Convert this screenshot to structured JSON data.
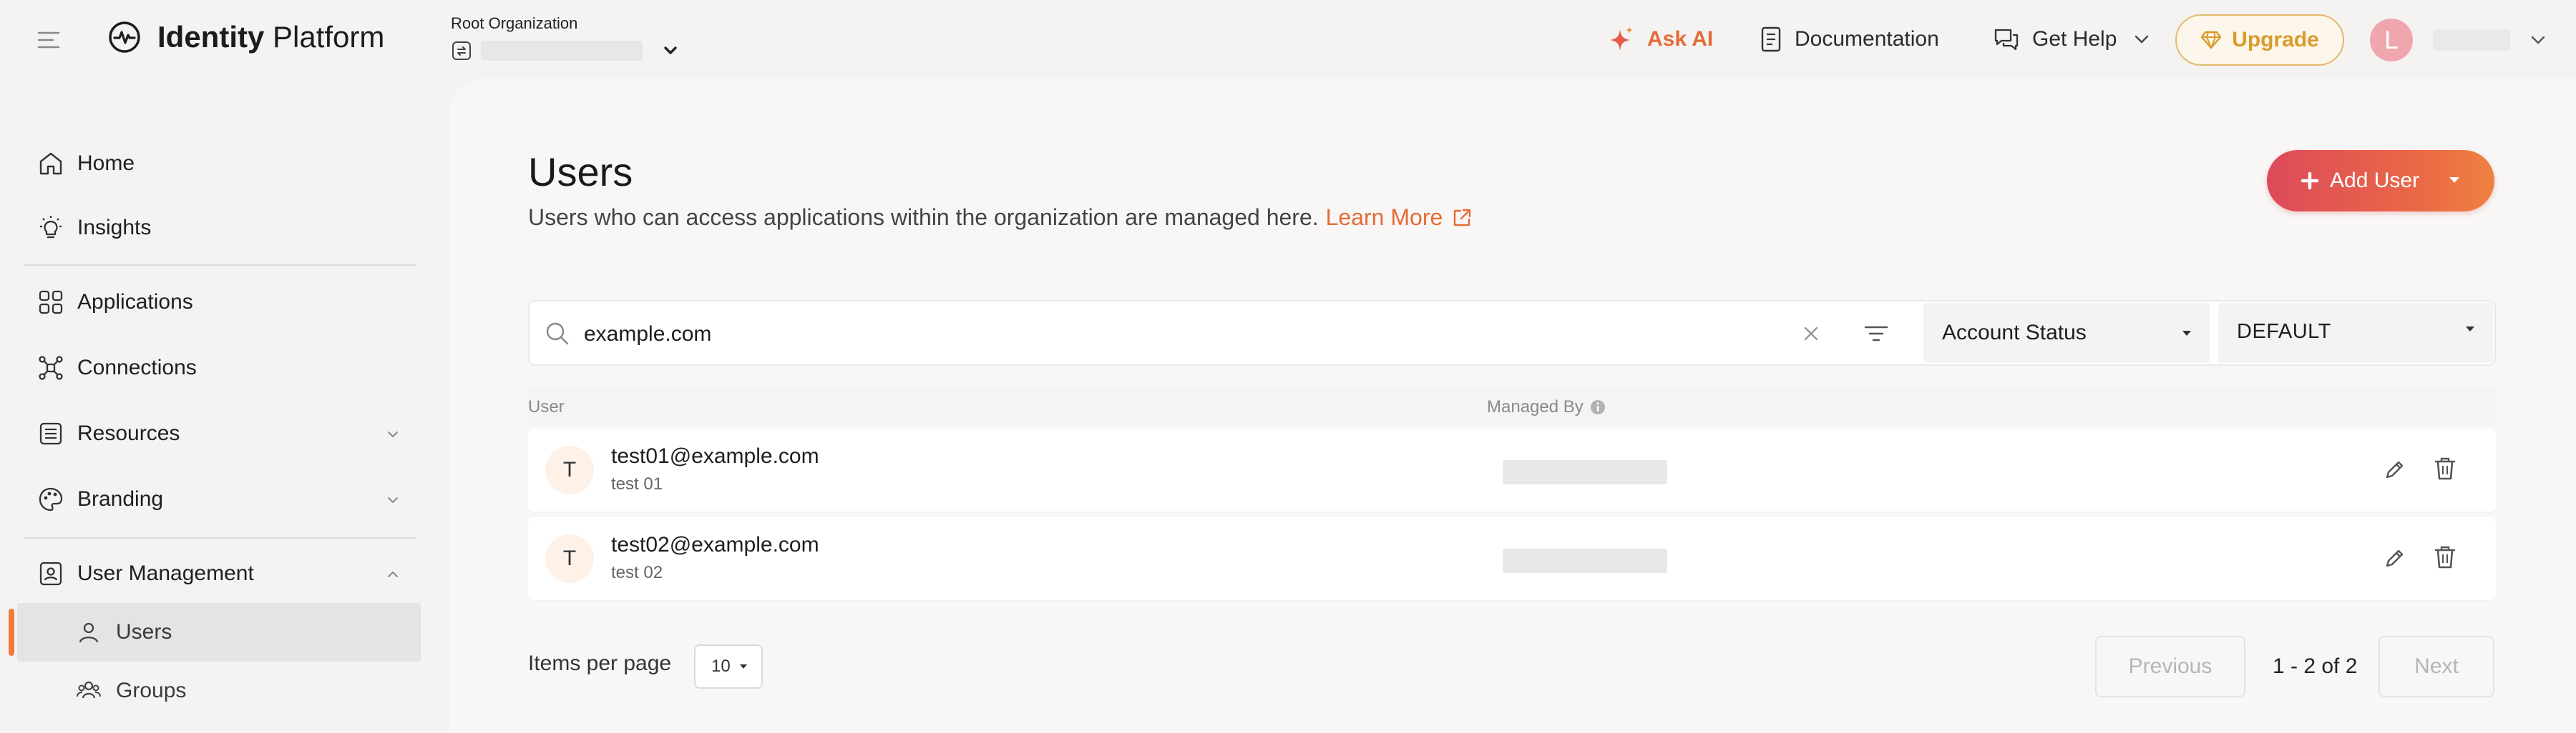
{
  "header": {
    "brand_prefix": "Identity",
    "brand_suffix": " Platform",
    "org_label": "Root Organization",
    "ask_ai": "Ask AI",
    "documentation": "Documentation",
    "get_help": "Get Help",
    "upgrade": "Upgrade",
    "avatar_initial": "L"
  },
  "sidebar": {
    "home": "Home",
    "insights": "Insights",
    "applications": "Applications",
    "connections": "Connections",
    "resources": "Resources",
    "branding": "Branding",
    "user_management": "User Management",
    "users": "Users",
    "groups": "Groups"
  },
  "page": {
    "title": "Users",
    "description": "Users who can access applications within the organization are managed here.",
    "learn_more": "Learn More",
    "add_user": "Add User"
  },
  "search": {
    "value": "example.com",
    "status_filter": "Account Status",
    "view_filter": "DEFAULT"
  },
  "table": {
    "col_user": "User",
    "col_managed_by": "Managed By",
    "rows": [
      {
        "initial": "T",
        "email": "test01@example.com",
        "name": "test 01"
      },
      {
        "initial": "T",
        "email": "test02@example.com",
        "name": "test 02"
      }
    ]
  },
  "pagination": {
    "items_per_page_label": "Items per page",
    "items_per_page": "10",
    "previous": "Previous",
    "range": "1 - 2 of 2",
    "next": "Next"
  },
  "colors": {
    "accent": "#e56b37",
    "upgrade_gold": "#d89b2c",
    "add_user_start": "#dd4a5b",
    "add_user_end": "#ee8240",
    "avatar_pink": "#f0a6ad"
  },
  "icons": [
    "menu-icon",
    "pulse-logo-icon",
    "org-switch-icon",
    "chevron-down-icon",
    "sparkle-icon",
    "document-icon",
    "chat-bubbles-icon",
    "diamond-icon",
    "home-icon",
    "lightbulb-icon",
    "grid-icon",
    "network-icon",
    "list-icon",
    "palette-icon",
    "id-badge-icon",
    "person-icon",
    "group-icon",
    "external-link-icon",
    "plus-icon",
    "search-icon",
    "clear-icon",
    "filter-icon",
    "info-icon",
    "pencil-icon",
    "trash-icon"
  ]
}
